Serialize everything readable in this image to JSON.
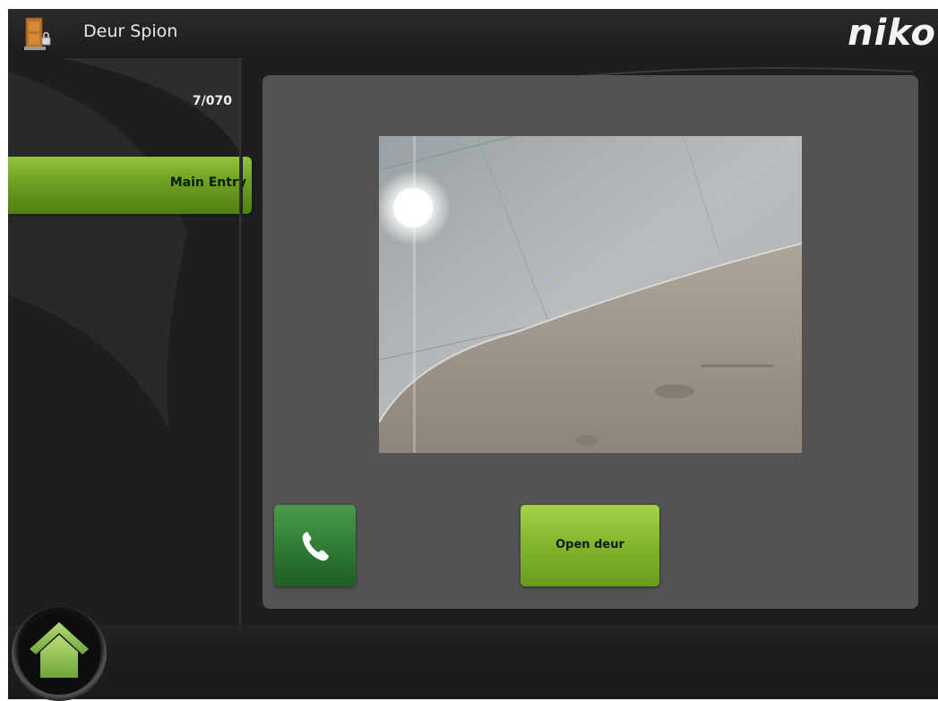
{
  "header": {
    "title": "Deur Spion",
    "brand": "niko",
    "app_icon": "door-icon"
  },
  "sidebar": {
    "panel_code": "7/070",
    "entries": [
      {
        "label": "Main Entry",
        "selected": true
      }
    ]
  },
  "main": {
    "camera": {
      "icon": "camera-feed"
    },
    "call_button": {
      "icon": "phone-icon"
    },
    "open_door_label": "Open deur"
  },
  "footer": {
    "home_icon": "home-icon"
  },
  "colors": {
    "accent_green": "#82b52c",
    "call_green": "#2f7a34",
    "panel_gray": "#535353",
    "background": "#1e1e1e"
  }
}
